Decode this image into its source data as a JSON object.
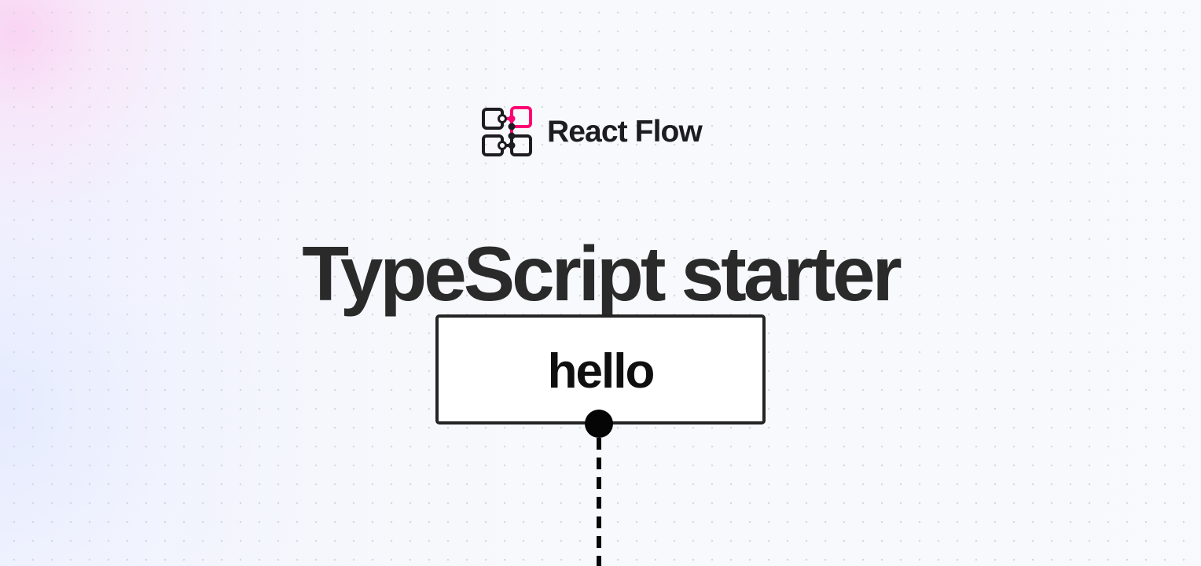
{
  "brand": {
    "name": "React Flow",
    "logo_icon": "react-flow-logo-icon",
    "accent_color": "#ff0073",
    "text_color": "#1c1c22"
  },
  "page": {
    "title": "TypeScript starter"
  },
  "canvas": {
    "background": "dotted-grid",
    "node": {
      "label": "hello",
      "handle_icon": "connection-handle",
      "edge_style": "dashed"
    }
  }
}
